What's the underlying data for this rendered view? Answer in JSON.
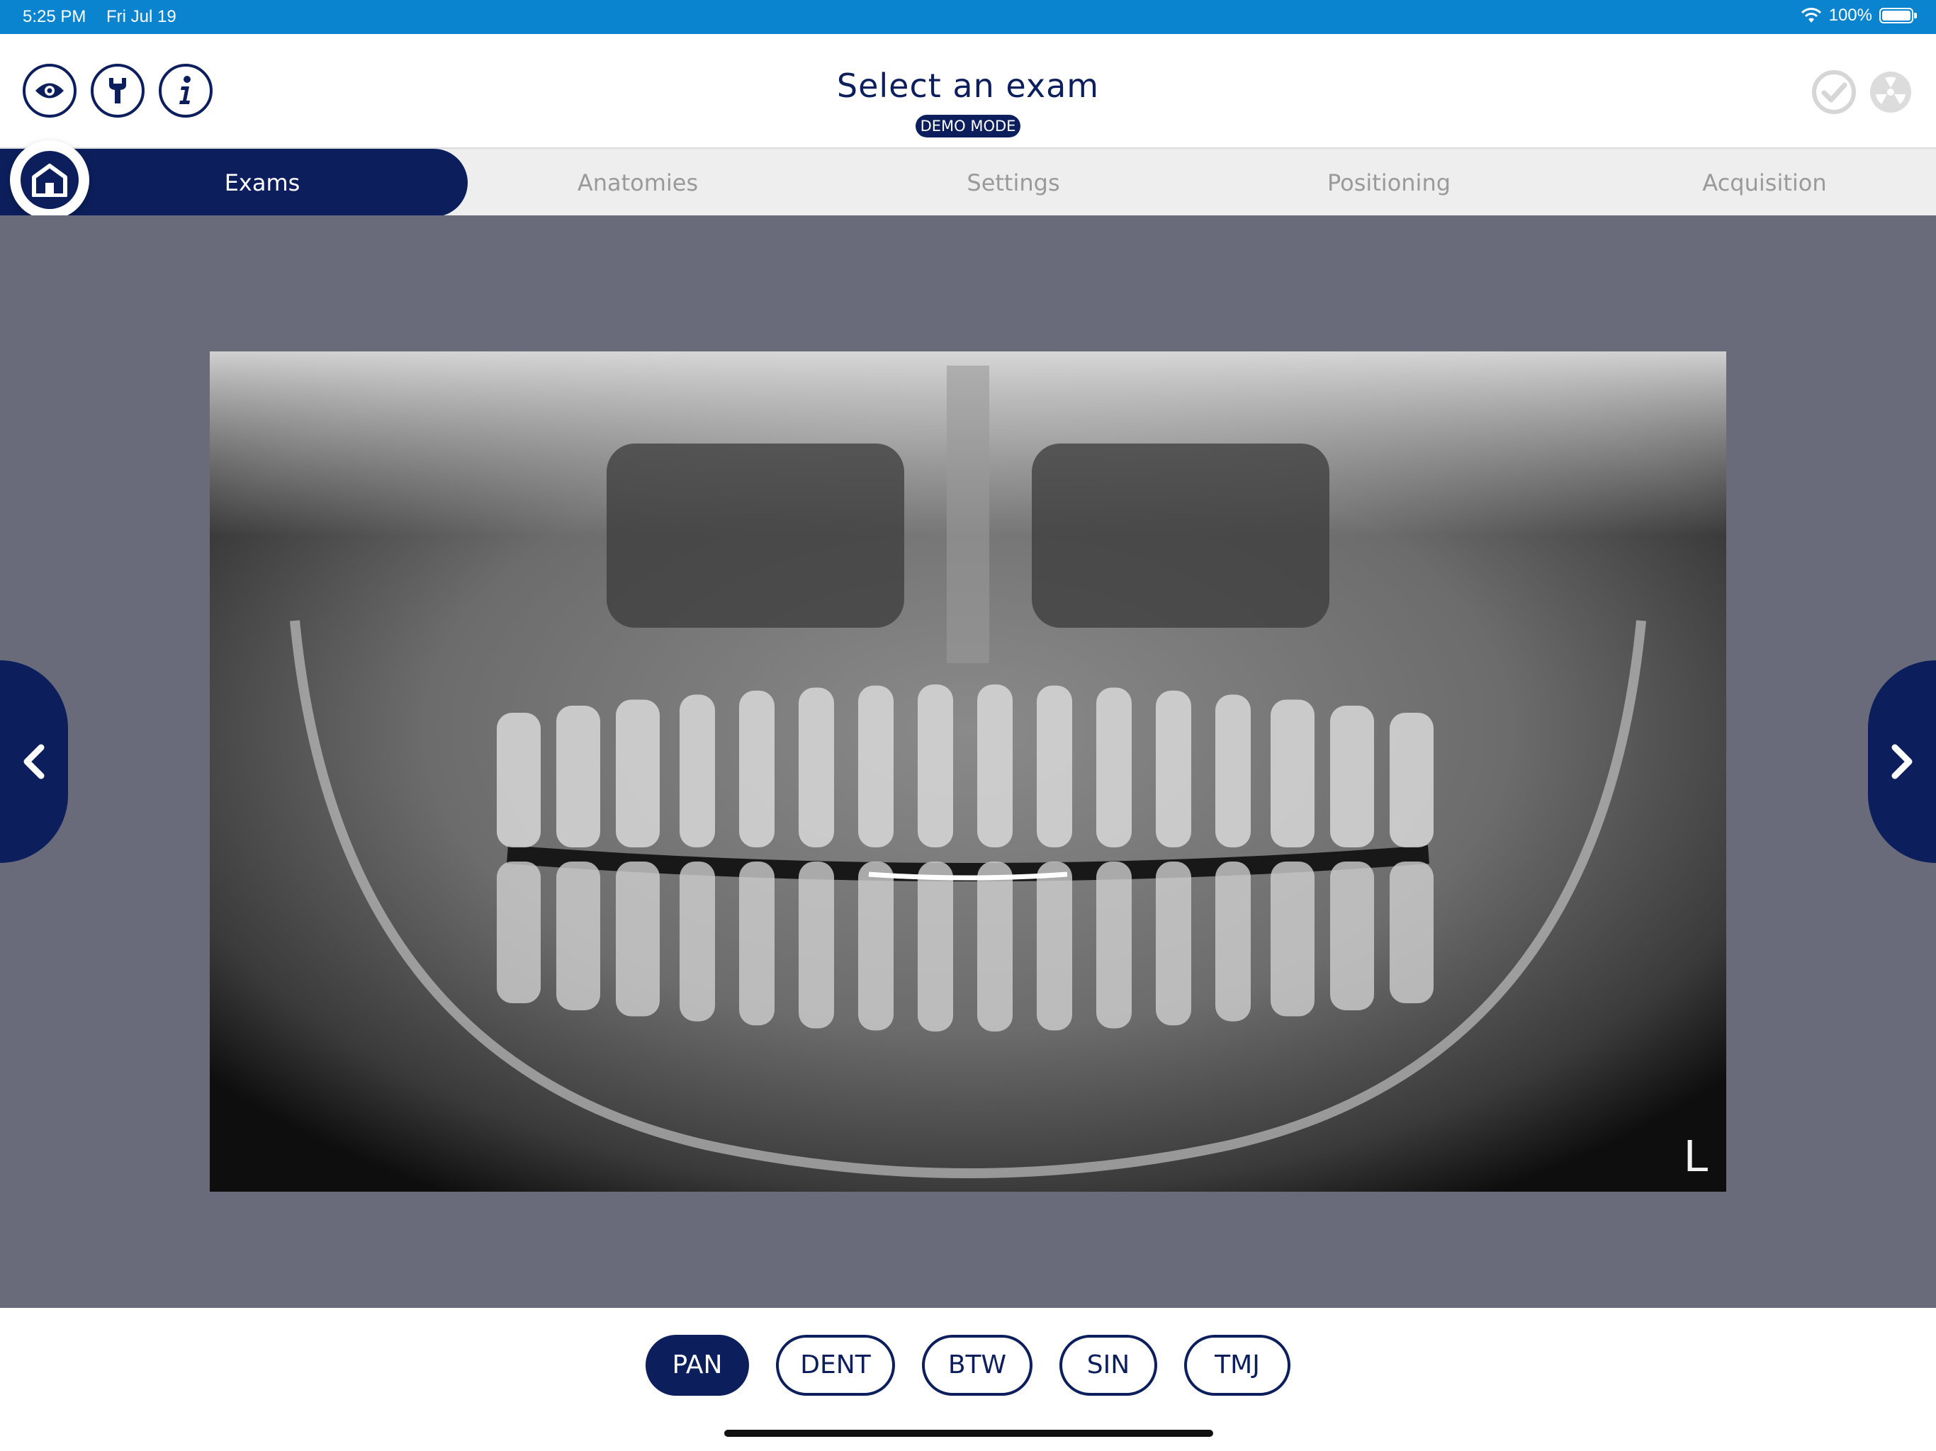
{
  "status_bar": {
    "time": "5:25 PM",
    "date": "Fri Jul 19",
    "battery_text": "100%",
    "battery_level": 1.0,
    "color": "#0a84cf"
  },
  "header": {
    "title": "Select an exam",
    "badge": "DEMO MODE",
    "left_buttons": [
      {
        "icon": "eye-icon"
      },
      {
        "icon": "wrench-icon"
      },
      {
        "icon": "info-icon"
      }
    ],
    "right_icons": [
      "check-icon",
      "radiation-icon"
    ]
  },
  "tabs": [
    {
      "label": "Exams",
      "active": true
    },
    {
      "label": "Anatomies",
      "active": false
    },
    {
      "label": "Settings",
      "active": false
    },
    {
      "label": "Positioning",
      "active": false
    },
    {
      "label": "Acquisition",
      "active": false
    }
  ],
  "preview": {
    "description_icon": "panoramic-xray-image",
    "side_marker": "L",
    "prev_icon": "chevron-left-icon",
    "next_icon": "chevron-right-icon"
  },
  "exam_types": [
    {
      "label": "PAN",
      "selected": true
    },
    {
      "label": "DENT",
      "selected": false
    },
    {
      "label": "BTW",
      "selected": false
    },
    {
      "label": "SIN",
      "selected": false
    },
    {
      "label": "TMJ",
      "selected": false
    }
  ],
  "colors": {
    "primary": "#0c1f5c",
    "content_bg": "#696b7a",
    "tab_inactive_text": "#9a9a9a",
    "tabbar_bg": "#eeeeee"
  }
}
